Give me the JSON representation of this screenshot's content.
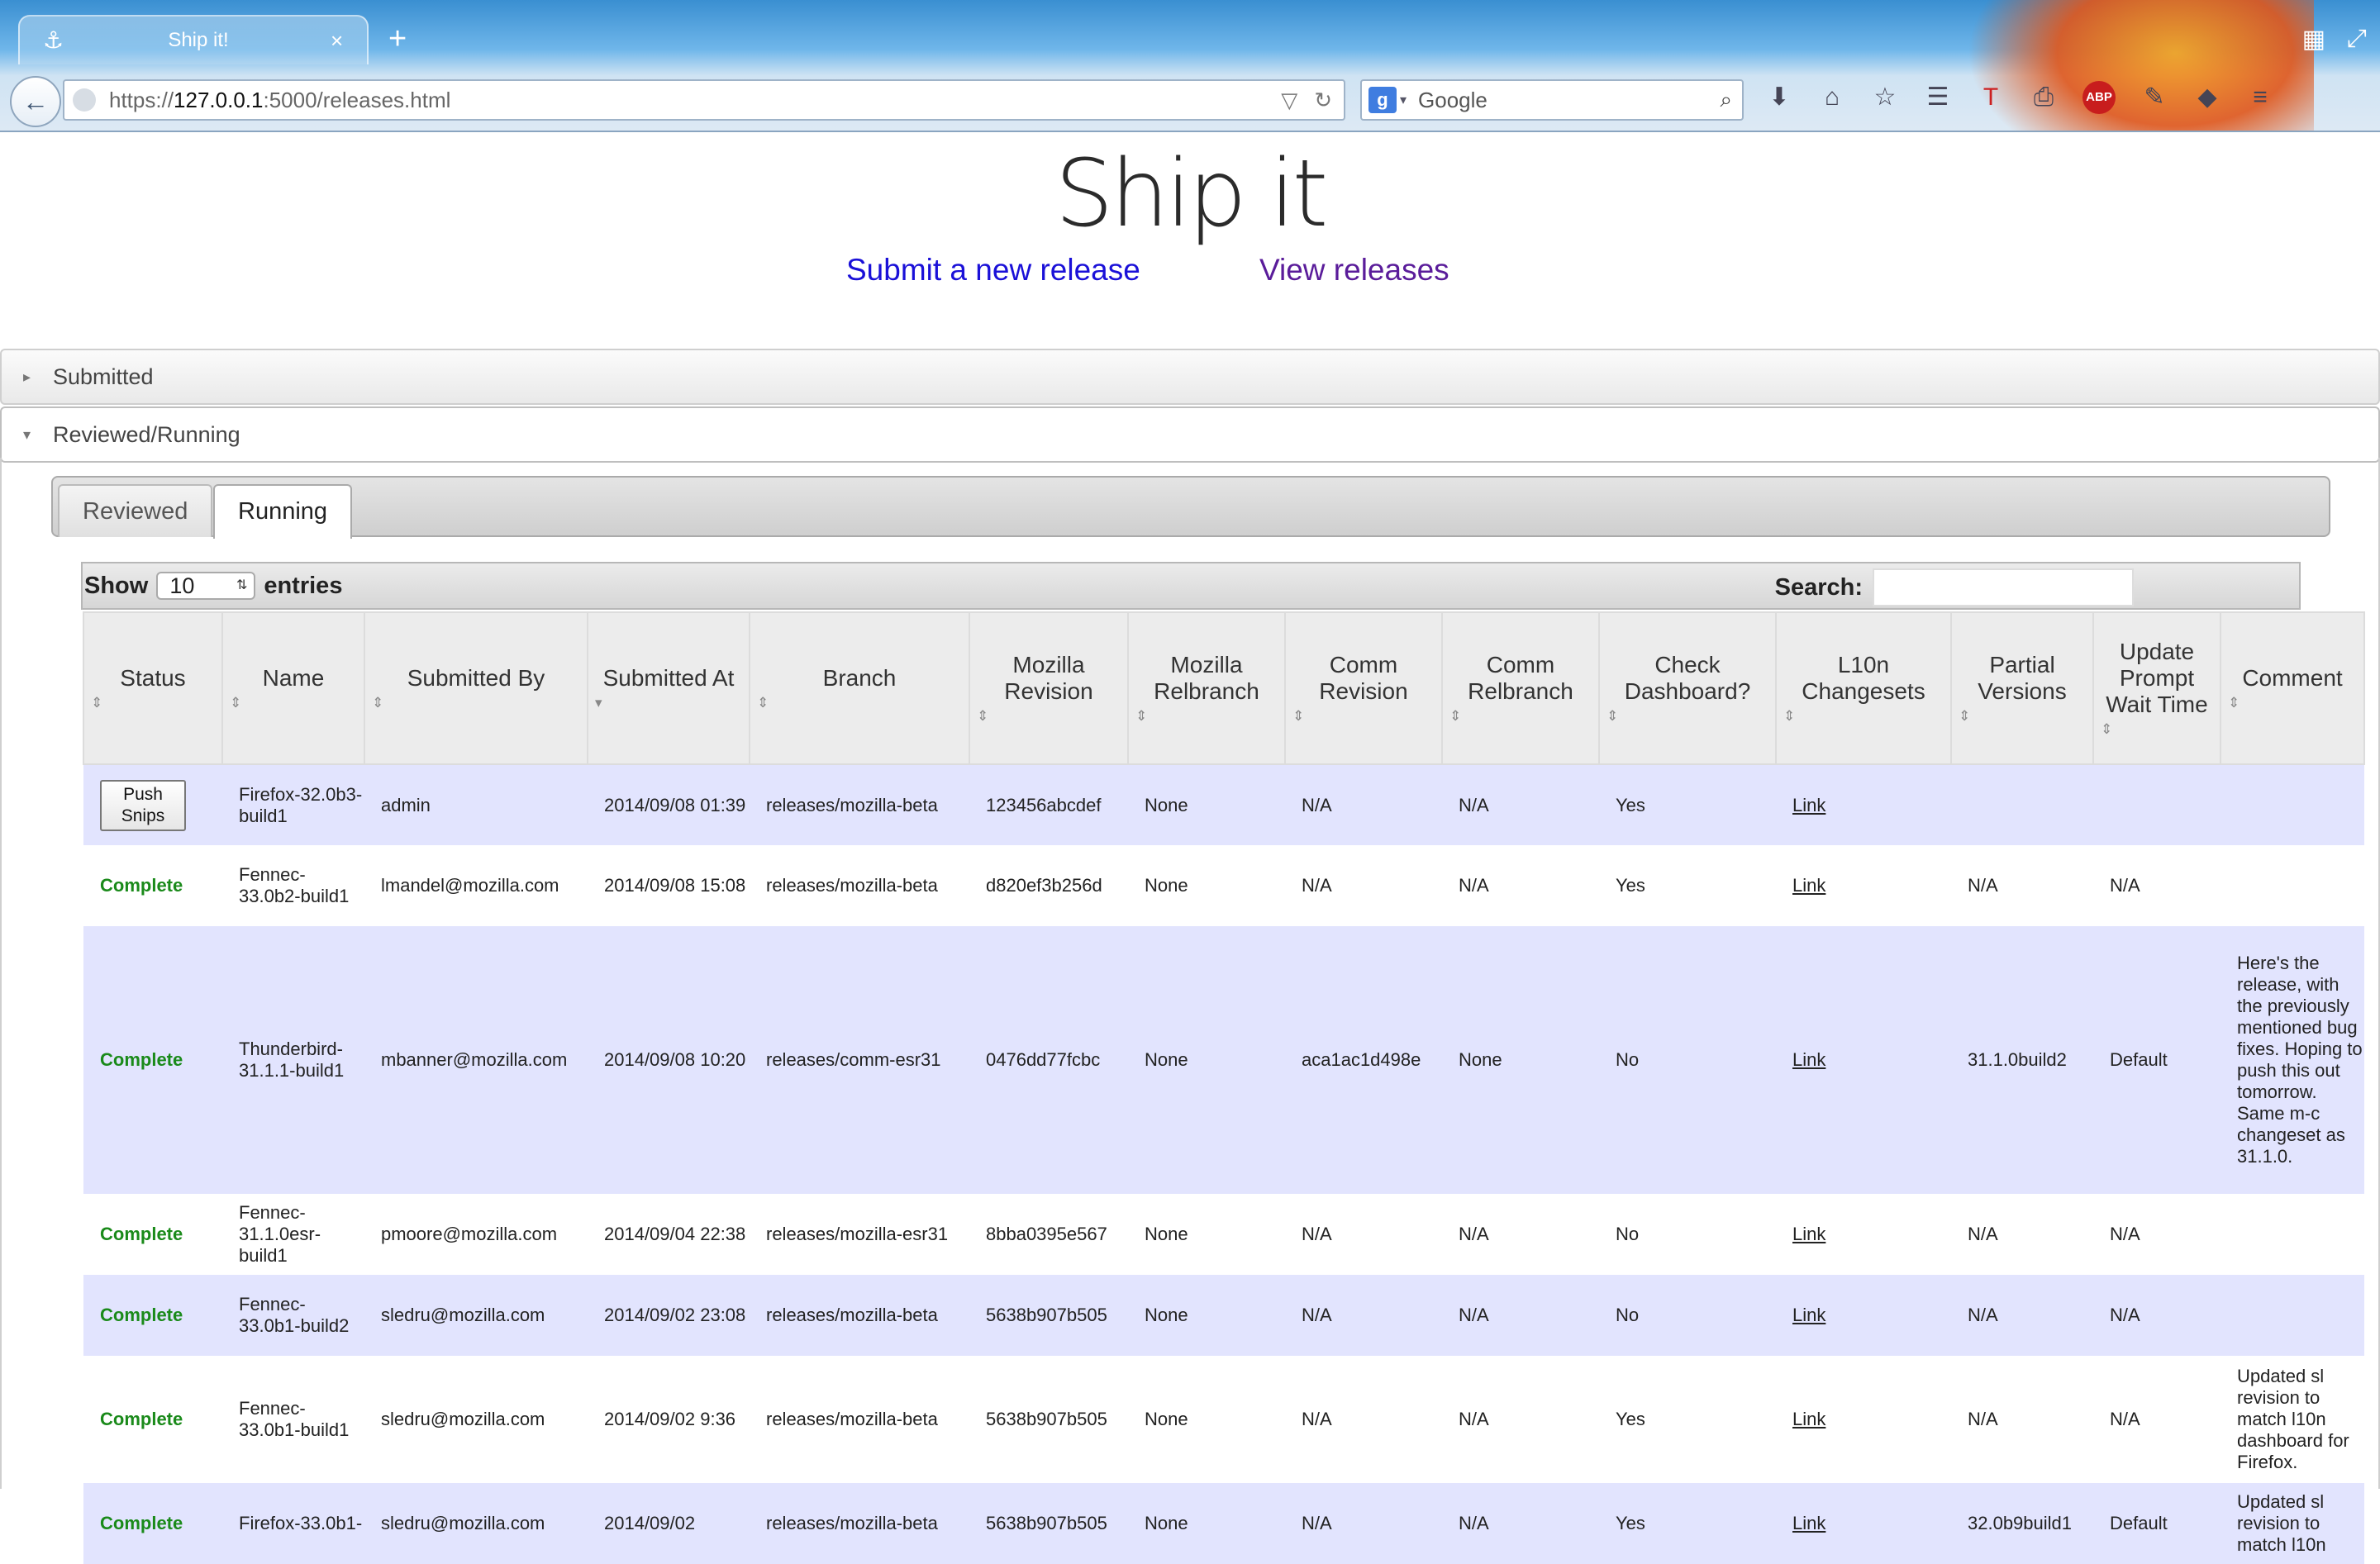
{
  "browser": {
    "tab_title": "Ship it!",
    "tab_close": "×",
    "new_tab": "+",
    "url_prefix": "https://",
    "url_host": "127.0.0.1",
    "url_rest": ":5000/releases.html",
    "search_engine_badge": "g",
    "search_placeholder": "Google",
    "icons": [
      "download-icon",
      "home-icon",
      "bookmark-star-icon",
      "reading-list-icon",
      "t-addon-icon",
      "printer-icon",
      "adblock-icon",
      "dev-tools-icon",
      "pocket-icon",
      "menu-icon"
    ],
    "abp_label": "ABP"
  },
  "header": {
    "title": "Ship it",
    "nav_new": "Submit a new release",
    "nav_view": "View releases"
  },
  "sections": {
    "submitted": "Submitted",
    "reviewed_running": "Reviewed/Running"
  },
  "tabs": [
    "Reviewed",
    "Running"
  ],
  "datatable": {
    "show_label": "Show",
    "length_value": "10",
    "entries_label": "entries",
    "search_label": "Search:",
    "search_value": ""
  },
  "table": {
    "columns": [
      "Status",
      "Name",
      "Submitted By",
      "Submitted At",
      "Branch",
      "Mozilla Revision",
      "Mozilla Relbranch",
      "Comm Revision",
      "Comm Relbranch",
      "Check Dashboard?",
      "L10n Changesets",
      "Partial Versions",
      "Update Prompt Wait Time",
      "Comment"
    ],
    "rows": [
      {
        "status": "Push Snips",
        "status_is_button": true,
        "name": "Firefox-32.0b3-build1",
        "submitted_by": "admin",
        "submitted_at": "2014/09/08 01:39",
        "branch": "releases/mozilla-beta",
        "mozilla_revision": "123456abcdef",
        "mozilla_relbranch": "None",
        "comm_revision": "N/A",
        "comm_relbranch": "N/A",
        "check_dashboard": "Yes",
        "l10n": "Link",
        "partial_versions": "",
        "update_wait": "",
        "comment": ""
      },
      {
        "status": "Complete",
        "name": "Fennec-33.0b2-build1",
        "submitted_by": "lmandel@mozilla.com",
        "submitted_at": "2014/09/08 15:08",
        "branch": "releases/mozilla-beta",
        "mozilla_revision": "d820ef3b256d",
        "mozilla_relbranch": "None",
        "comm_revision": "N/A",
        "comm_relbranch": "N/A",
        "check_dashboard": "Yes",
        "l10n": "Link",
        "partial_versions": "N/A",
        "update_wait": "N/A",
        "comment": ""
      },
      {
        "status": "Complete",
        "name": "Thunderbird-31.1.1-build1",
        "submitted_by": "mbanner@mozilla.com",
        "submitted_at": "2014/09/08 10:20",
        "branch": "releases/comm-esr31",
        "mozilla_revision": "0476dd77fcbc",
        "mozilla_relbranch": "None",
        "comm_revision": "aca1ac1d498e",
        "comm_relbranch": "None",
        "check_dashboard": "No",
        "l10n": "Link",
        "partial_versions": "31.1.0build2",
        "update_wait": "Default",
        "comment": "Here's the release, with the previously mentioned bug fixes. Hoping to push this out tomorrow. Same m-c changeset as 31.1.0."
      },
      {
        "status": "Complete",
        "name": "Fennec-31.1.0esr-build1",
        "submitted_by": "pmoore@mozilla.com",
        "submitted_at": "2014/09/04 22:38",
        "branch": "releases/mozilla-esr31",
        "mozilla_revision": "8bba0395e567",
        "mozilla_relbranch": "None",
        "comm_revision": "N/A",
        "comm_relbranch": "N/A",
        "check_dashboard": "No",
        "l10n": "Link",
        "partial_versions": "N/A",
        "update_wait": "N/A",
        "comment": ""
      },
      {
        "status": "Complete",
        "name": "Fennec-33.0b1-build2",
        "submitted_by": "sledru@mozilla.com",
        "submitted_at": "2014/09/02 23:08",
        "branch": "releases/mozilla-beta",
        "mozilla_revision": "5638b907b505",
        "mozilla_relbranch": "None",
        "comm_revision": "N/A",
        "comm_relbranch": "N/A",
        "check_dashboard": "No",
        "l10n": "Link",
        "partial_versions": "N/A",
        "update_wait": "N/A",
        "comment": ""
      },
      {
        "status": "Complete",
        "name": "Fennec-33.0b1-build1",
        "submitted_by": "sledru@mozilla.com",
        "submitted_at": "2014/09/02 9:36",
        "branch": "releases/mozilla-beta",
        "mozilla_revision": "5638b907b505",
        "mozilla_relbranch": "None",
        "comm_revision": "N/A",
        "comm_relbranch": "N/A",
        "check_dashboard": "Yes",
        "l10n": "Link",
        "partial_versions": "N/A",
        "update_wait": "N/A",
        "comment": "Updated sl revision to match l10n dashboard for Firefox."
      },
      {
        "status": "Complete",
        "name": "Firefox-33.0b1-",
        "submitted_by": "sledru@mozilla.com",
        "submitted_at": "2014/09/02",
        "branch": "releases/mozilla-beta",
        "mozilla_revision": "5638b907b505",
        "mozilla_relbranch": "None",
        "comm_revision": "N/A",
        "comm_relbranch": "N/A",
        "check_dashboard": "Yes",
        "l10n": "Link",
        "partial_versions": "32.0b9build1",
        "update_wait": "Default",
        "comment": "Updated sl revision to match l10n"
      }
    ]
  }
}
